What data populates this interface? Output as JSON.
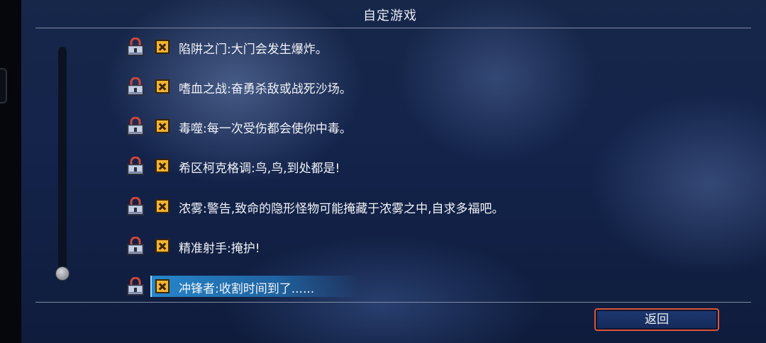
{
  "title": "自定游戏",
  "options": [
    {
      "label": "陷阱之门:大门会发生爆炸。",
      "locked": true,
      "checked": false
    },
    {
      "label": "嗜血之战:奋勇杀敌或战死沙场。",
      "locked": true,
      "checked": false
    },
    {
      "label": "毒噬:每一次受伤都会使你中毒。",
      "locked": true,
      "checked": false
    },
    {
      "label": "希区柯克格调:鸟,鸟,到处都是!",
      "locked": true,
      "checked": false
    },
    {
      "label": "浓雾:警告,致命的隐形怪物可能掩藏于浓雾之中,自求多福吧。",
      "locked": true,
      "checked": false
    },
    {
      "label": "精准射手:掩护!",
      "locked": true,
      "checked": false
    },
    {
      "label": "冲锋者:收割时间到了......",
      "locked": true,
      "checked": false,
      "selected": true
    }
  ],
  "scroll_position": 1.0,
  "back_button": "返回",
  "colors": {
    "accent_border": "#d9553a",
    "selection": "#288cd2",
    "checkbox": "#f2b431"
  },
  "icons": {
    "lock": "padlock-icon",
    "checkbox": "x-checkbox-icon"
  }
}
